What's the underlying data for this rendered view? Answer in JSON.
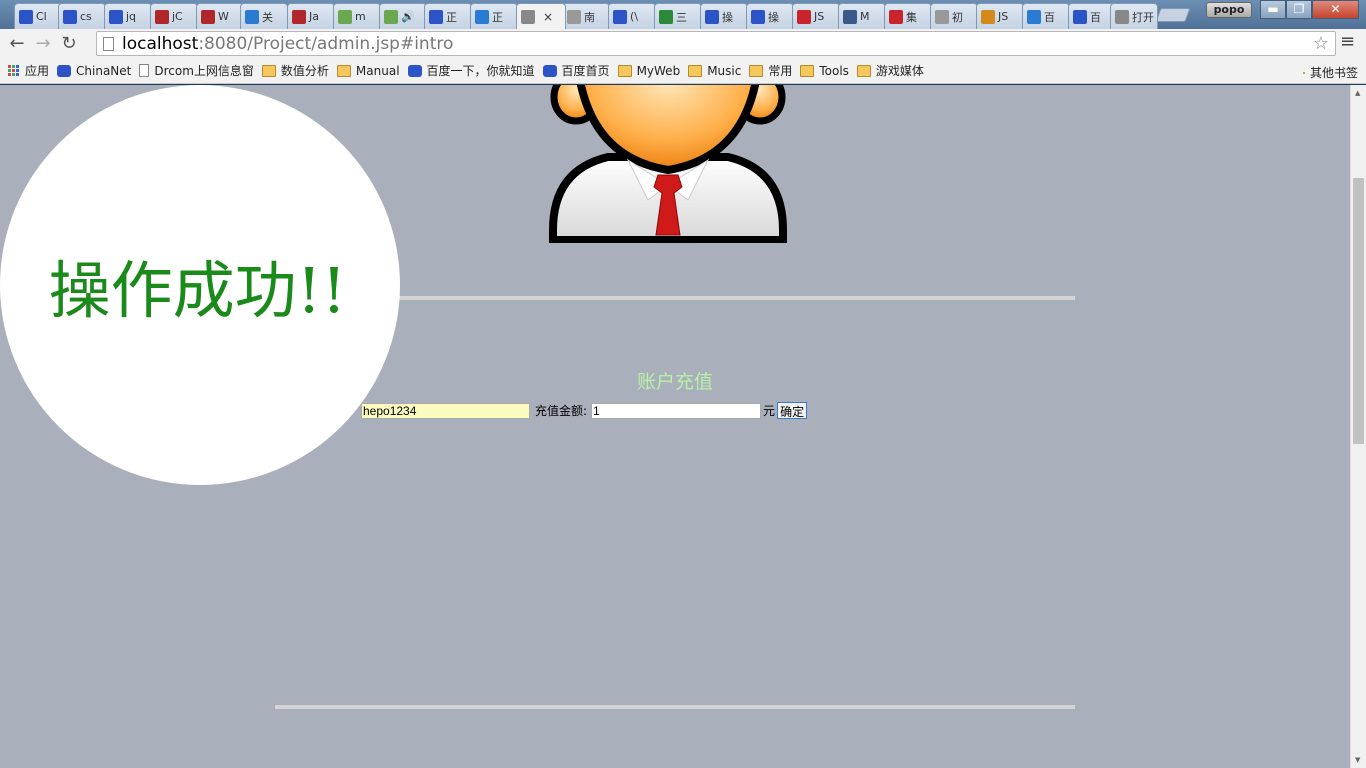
{
  "browser": {
    "tabs": [
      {
        "label": "Cl",
        "fav": "paw-icon",
        "color": "#2d54c7"
      },
      {
        "label": "cs",
        "fav": "paw-icon",
        "color": "#2d54c7"
      },
      {
        "label": "jq",
        "fav": "paw-icon",
        "color": "#2d54c7"
      },
      {
        "label": "jC",
        "fav": "w3-icon",
        "color": "#b0272b"
      },
      {
        "label": "W",
        "fav": "w3-icon",
        "color": "#b0272b"
      },
      {
        "label": "关",
        "fav": "globe-icon",
        "color": "#2a7bd4"
      },
      {
        "label": "Ja",
        "fav": "w3-icon",
        "color": "#b0272b"
      },
      {
        "label": "m",
        "fav": "m-icon",
        "color": "#6aa84f"
      },
      {
        "label": "🔊",
        "fav": "m-icon",
        "color": "#6aa84f"
      },
      {
        "label": "正",
        "fav": "paw-icon",
        "color": "#2d54c7"
      },
      {
        "label": "正",
        "fav": "globe-icon",
        "color": "#2a7bd4"
      },
      {
        "label": "",
        "fav": "image-icon",
        "color": "#888888",
        "active": true
      },
      {
        "label": "南",
        "fav": "page-icon",
        "color": "#999999"
      },
      {
        "label": "(\\",
        "fav": "paw-icon",
        "color": "#2d54c7"
      },
      {
        "label": "三",
        "fav": "douban-icon",
        "color": "#2a8a3a"
      },
      {
        "label": "操",
        "fav": "paw-icon",
        "color": "#2d54c7"
      },
      {
        "label": "操",
        "fav": "paw-icon",
        "color": "#2d54c7"
      },
      {
        "label": "JS",
        "fav": "c-icon",
        "color": "#c8242b"
      },
      {
        "label": "M",
        "fav": "g-icon",
        "color": "#3a5a8a"
      },
      {
        "label": "集",
        "fav": "c-icon",
        "color": "#c8242b"
      },
      {
        "label": "初",
        "fav": "page-icon",
        "color": "#999999"
      },
      {
        "label": "JS",
        "fav": "puzzle-icon",
        "color": "#d48a1a"
      },
      {
        "label": "百",
        "fav": "translate-icon",
        "color": "#2a7bd4"
      },
      {
        "label": "百",
        "fav": "paw-icon",
        "color": "#2d54c7"
      },
      {
        "label": "打开",
        "fav": "none",
        "color": "#888888"
      }
    ],
    "close_glyph": "×",
    "profile_name": "popo",
    "window_buttons": {
      "minimize": "▬",
      "maximize": "❐",
      "close": "✕"
    },
    "nav": {
      "back": "←",
      "forward": "→",
      "reload": "↻"
    },
    "url_host": "localhost",
    "url_path": ":8080/Project/admin.jsp#intro",
    "star_glyph": "☆",
    "menu_glyph": "≡"
  },
  "bookmarks": {
    "items": [
      {
        "label": "应用",
        "icon": "apps-icon"
      },
      {
        "label": "ChinaNet",
        "icon": "paw-icon"
      },
      {
        "label": "Drcom上网信息窗",
        "icon": "page-icon"
      },
      {
        "label": "数值分析",
        "icon": "folder-icon"
      },
      {
        "label": "Manual",
        "icon": "folder-icon"
      },
      {
        "label": "百度一下，你就知道",
        "icon": "paw-icon"
      },
      {
        "label": "百度首页",
        "icon": "paw-icon"
      },
      {
        "label": "MyWeb",
        "icon": "folder-icon"
      },
      {
        "label": "Music",
        "icon": "folder-icon"
      },
      {
        "label": "常用",
        "icon": "folder-icon"
      },
      {
        "label": "Tools",
        "icon": "folder-icon"
      },
      {
        "label": "游戏媒体",
        "icon": "folder-icon"
      }
    ],
    "other": "其他书签"
  },
  "page": {
    "success_message": "操作成功!!",
    "recharge_title": "账户充值",
    "username_value": "hepo1234",
    "amount_label": "充值金额:",
    "amount_value": "1",
    "unit_label": "元",
    "confirm_label": "确定"
  },
  "colors": {
    "page_background": "#a9afbb",
    "success_text": "#1a8a1a",
    "title_text": "#b8f0a8",
    "username_bg": "#fbfbc0"
  }
}
